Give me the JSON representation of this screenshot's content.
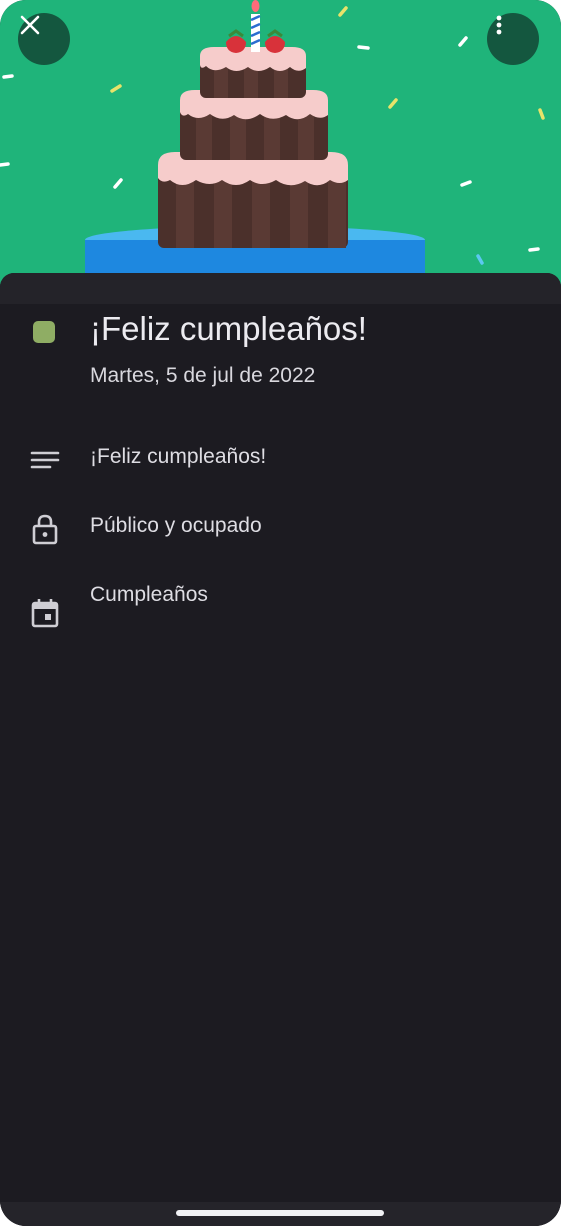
{
  "event": {
    "title": "¡Feliz cumpleaños!",
    "date": "Martes, 5 de jul de 2022",
    "color": "#8fad64"
  },
  "details": [
    {
      "icon": "notes-icon",
      "label": "¡Feliz cumpleaños!"
    },
    {
      "icon": "lock-icon",
      "label": "Público y ocupado"
    },
    {
      "icon": "calendar-icon",
      "label": "Cumpleaños"
    }
  ],
  "header": {
    "background": "#1fb47a",
    "close_icon": "close-icon",
    "more_icon": "more-vert-icon"
  }
}
